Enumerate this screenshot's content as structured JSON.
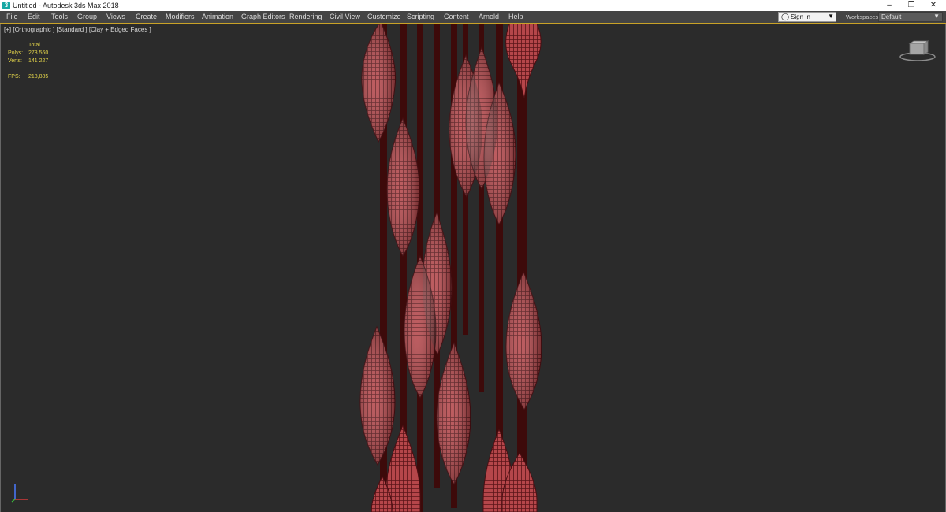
{
  "window": {
    "title": "Untitled - Autodesk 3ds Max 2018",
    "controls": [
      "–",
      "❐",
      "✕"
    ]
  },
  "menu": {
    "items": [
      {
        "label": "File",
        "mn": "F",
        "rest": "ile"
      },
      {
        "label": "Edit",
        "mn": "E",
        "rest": "dit"
      },
      {
        "label": "Tools",
        "mn": "T",
        "rest": "ools"
      },
      {
        "label": "Group",
        "mn": "G",
        "rest": "roup"
      },
      {
        "label": "Views",
        "mn": "V",
        "rest": "iews"
      },
      {
        "label": "Create",
        "mn": "C",
        "rest": "reate"
      },
      {
        "label": "Modifiers",
        "mn": "M",
        "rest": "odifiers"
      },
      {
        "label": "Animation",
        "mn": "A",
        "rest": "nimation"
      },
      {
        "label": "Graph Editors",
        "mn": "G",
        "rest": "raph Editors"
      },
      {
        "label": "Rendering",
        "mn": "R",
        "rest": "endering"
      },
      {
        "label": "Civil View",
        "mn": "",
        "rest": "Civil View"
      },
      {
        "label": "Customize",
        "mn": "C",
        "rest": "ustomize"
      },
      {
        "label": "Scripting",
        "mn": "S",
        "rest": "cripting"
      },
      {
        "label": "Content",
        "mn": "",
        "rest": "Content"
      },
      {
        "label": "Arnold",
        "mn": "",
        "rest": "Arnold"
      },
      {
        "label": "Help",
        "mn": "H",
        "rest": "elp"
      }
    ],
    "sign_in": "Sign In",
    "workspaces_label": "Workspaces:",
    "workspace_value": "Default"
  },
  "viewport": {
    "label": "[+] [Orthographic ] [Standard ] [Clay + Edged Faces ]",
    "stats": {
      "header": "Total",
      "polys_label": "Polys:",
      "polys_value": "273 560",
      "verts_label": "Verts:",
      "verts_value": "141 227",
      "fps_label": "FPS:",
      "fps_value": "218,885"
    }
  },
  "colors": {
    "accent": "#c9a227",
    "stats_text": "#e3d44a",
    "rod": "#3d0a0a",
    "mesh_fill": "#b5464a",
    "mesh_wire": "#5a1418"
  },
  "icons": {
    "app": "3ds-max-logo-icon",
    "sign_in": "person-icon",
    "viewcube": "viewcube-icon",
    "gizmo": "axis-gizmo-icon"
  }
}
